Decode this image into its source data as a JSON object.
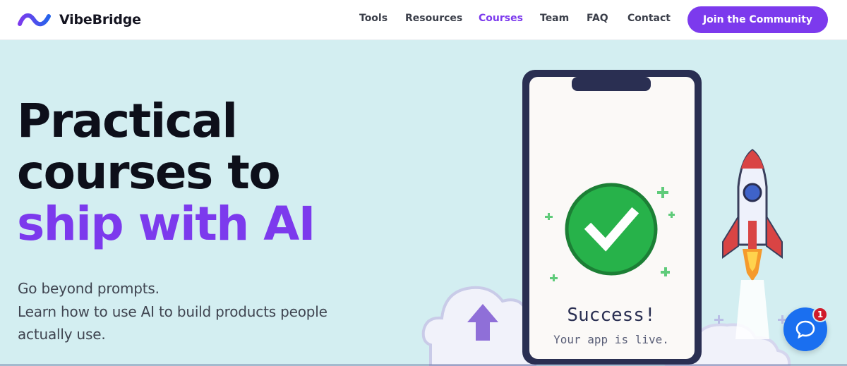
{
  "brand": {
    "name": "VibeBridge",
    "logo_icon": "wave-logo-icon",
    "logo_colors": [
      "#7c3aed",
      "#2563eb"
    ]
  },
  "nav": {
    "items": [
      {
        "label": "Tools"
      },
      {
        "label": "Resources"
      },
      {
        "label": "Courses",
        "active": true
      },
      {
        "label": "Team"
      },
      {
        "label": "FAQ"
      },
      {
        "label": "Contact"
      }
    ],
    "cta_label": "Join the Community"
  },
  "hero": {
    "headline_lines": [
      "Practical",
      "courses to"
    ],
    "headline_accent": "ship with AI",
    "subtext_lines": [
      "Go beyond prompts.",
      "Learn how to use AI to build products people",
      "actually use."
    ]
  },
  "illustration": {
    "success_title": "Success!",
    "success_subtitle": "Your app is live.",
    "icons": [
      "phone-icon",
      "checkmark-icon",
      "rocket-icon",
      "cloud-upload-icon",
      "sparkle-icon"
    ]
  },
  "chat": {
    "icon": "chat-bubble-icon",
    "badge_count": "1"
  },
  "colors": {
    "accent": "#7c3aed",
    "hero_background": "#d3eef1",
    "headline": "#0d0f1a",
    "success_green": "#27b24a",
    "chat_blue": "#1a6ff0",
    "badge_red": "#d01b2a"
  }
}
